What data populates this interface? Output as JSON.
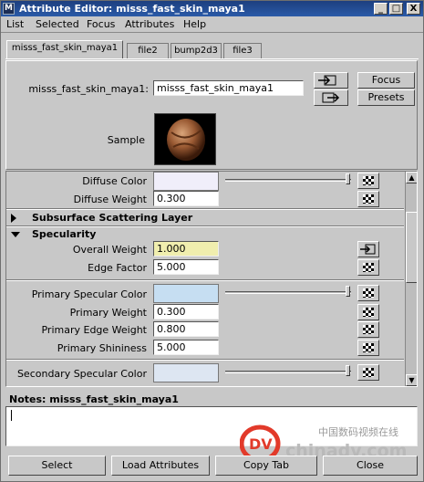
{
  "window": {
    "title": "Attribute Editor: misss_fast_skin_maya1",
    "controls": [
      "_",
      "□",
      "X"
    ]
  },
  "menubar": [
    "List",
    "Selected",
    "Focus",
    "Attributes",
    "Help"
  ],
  "tabs": [
    {
      "label": "misss_fast_skin_maya1",
      "active": true
    },
    {
      "label": "file2",
      "active": false
    },
    {
      "label": "bump2d3",
      "active": false
    },
    {
      "label": "file3",
      "active": false
    }
  ],
  "header": {
    "node_label": "misss_fast_skin_maya1:",
    "node_value": "misss_fast_skin_maya1",
    "focus_label": "Focus",
    "presets_label": "Presets",
    "sample_label": "Sample"
  },
  "attributes": {
    "diffuse_color_label": "Diffuse Color",
    "diffuse_weight_label": "Diffuse Weight",
    "diffuse_weight_value": "0.300",
    "subsurface_section": "Subsurface Scattering Layer",
    "specularity_section": "Specularity",
    "overall_weight_label": "Overall Weight",
    "overall_weight_value": "1.000",
    "edge_factor_label": "Edge Factor",
    "edge_factor_value": "5.000",
    "primary_specular_color_label": "Primary Specular Color",
    "primary_weight_label": "Primary Weight",
    "primary_weight_value": "0.300",
    "primary_edge_weight_label": "Primary Edge Weight",
    "primary_edge_weight_value": "0.800",
    "primary_shininess_label": "Primary Shininess",
    "primary_shininess_value": "5.000",
    "secondary_specular_color_label": "Secondary Specular Color"
  },
  "colors": {
    "diffuse_swatch": "#f0eefa",
    "primary_spec_swatch": "#c6def2",
    "secondary_spec_swatch": "#dde6f2",
    "title_bar": "#1d3f7f"
  },
  "notes": {
    "label": "Notes: misss_fast_skin_maya1",
    "value": ""
  },
  "bottom_buttons": [
    "Select",
    "Load Attributes",
    "Copy Tab",
    "Close"
  ],
  "watermark": {
    "cn": "中国数码视频在线",
    "site": "chinadv.com",
    "logo": "DV"
  }
}
